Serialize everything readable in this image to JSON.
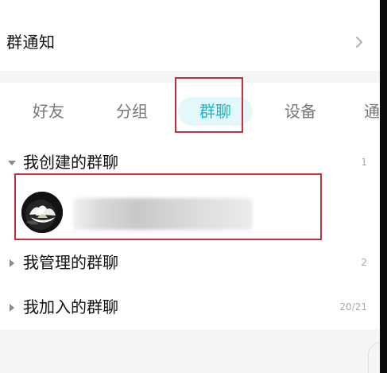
{
  "notice": {
    "label": "群通知",
    "icon": "chevron-right-icon"
  },
  "tabs": [
    {
      "label": "好友",
      "selected": false
    },
    {
      "label": "分组",
      "selected": false
    },
    {
      "label": "群聊",
      "selected": true
    },
    {
      "label": "设备",
      "selected": false
    },
    {
      "label": "通",
      "selected": false
    }
  ],
  "sections": {
    "created": {
      "title": "我创建的群聊",
      "count": "1",
      "expanded": true
    },
    "managed": {
      "title": "我管理的群聊",
      "count": "2",
      "expanded": false
    },
    "joined": {
      "title": "我加入的群聊",
      "count": "20/21",
      "expanded": false
    }
  },
  "created_group": {
    "avatar_icon": "white-lotus-avatar",
    "name": ""
  },
  "colors": {
    "accent": "#12b6cf",
    "accent_background": "#e4f8fb",
    "highlight_box": "#c0313a",
    "page_background": "#f4f5f7",
    "muted_text": "#777777"
  }
}
